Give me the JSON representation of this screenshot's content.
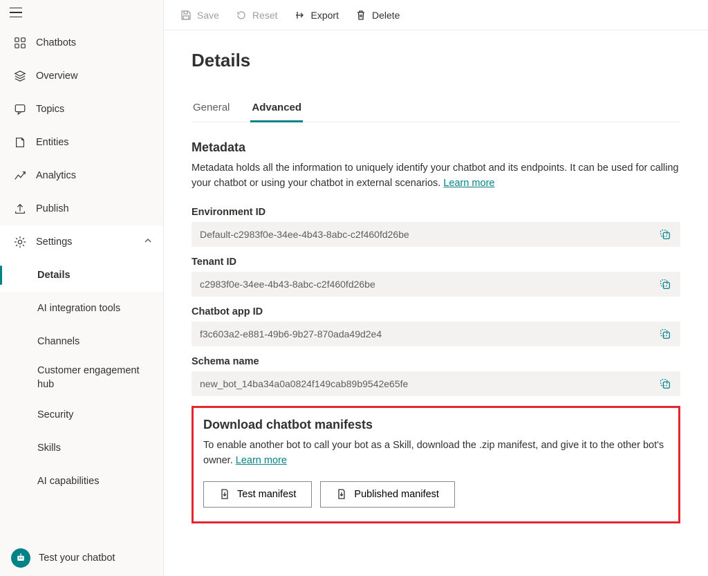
{
  "sidebar": {
    "items": [
      {
        "label": "Chatbots"
      },
      {
        "label": "Overview"
      },
      {
        "label": "Topics"
      },
      {
        "label": "Entities"
      },
      {
        "label": "Analytics"
      },
      {
        "label": "Publish"
      },
      {
        "label": "Settings"
      }
    ],
    "sub_items": [
      {
        "label": "Details"
      },
      {
        "label": "AI integration tools"
      },
      {
        "label": "Channels"
      },
      {
        "label": "Customer engagement hub"
      },
      {
        "label": "Security"
      },
      {
        "label": "Skills"
      },
      {
        "label": "AI capabilities"
      }
    ],
    "footer_label": "Test your chatbot"
  },
  "commands": {
    "save": "Save",
    "reset": "Reset",
    "export": "Export",
    "delete": "Delete"
  },
  "page": {
    "title": "Details",
    "tabs": [
      {
        "label": "General"
      },
      {
        "label": "Advanced"
      }
    ]
  },
  "metadata_section": {
    "title": "Metadata",
    "desc": "Metadata holds all the information to uniquely identify your chatbot and its endpoints. It can be used for calling your chatbot or using your chatbot in external scenarios. ",
    "learn_more": "Learn more"
  },
  "fields": {
    "env_id": {
      "label": "Environment ID",
      "value": "Default-c2983f0e-34ee-4b43-8abc-c2f460fd26be"
    },
    "tenant_id": {
      "label": "Tenant ID",
      "value": "c2983f0e-34ee-4b43-8abc-c2f460fd26be"
    },
    "app_id": {
      "label": "Chatbot app ID",
      "value": "f3c603a2-e881-49b6-9b27-870ada49d2e4"
    },
    "schema": {
      "label": "Schema name",
      "value": "new_bot_14ba34a0a0824f149cab89b9542e65fe"
    }
  },
  "manifests": {
    "title": "Download chatbot manifests",
    "desc": "To enable another bot to call your bot as a Skill, download the .zip manifest, and give it to the other bot's owner. ",
    "learn_more": "Learn more",
    "test_btn": "Test manifest",
    "pub_btn": "Published manifest"
  }
}
